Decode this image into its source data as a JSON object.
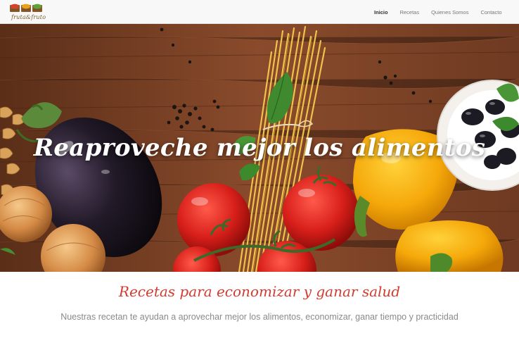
{
  "brand": {
    "logo_text": "fruta&fruto",
    "logo_icon": "fruit-crates-logo-icon",
    "crate_colors": [
      "#d9402b",
      "#e9a21a",
      "#5ea33a"
    ]
  },
  "nav": {
    "items": [
      {
        "label": "Inicio",
        "active": true
      },
      {
        "label": "Recetas",
        "active": false
      },
      {
        "label": "Quienes Somos",
        "active": false
      },
      {
        "label": "Contacto",
        "active": false
      }
    ]
  },
  "hero": {
    "title": "Reaproveche mejor los alimentos",
    "image_description_icon": "vegetables-hero-image"
  },
  "intro": {
    "heading": "Recetas para economizar y ganar salud",
    "text": "Nuestras recetan te ayudan a aprovechar mejor los alimentos, economizar, ganar tiempo y practicidad"
  },
  "colors": {
    "accent": "#d53a2f",
    "nav_bg": "#f8f8f8",
    "muted_text": "#8a8a8a"
  }
}
